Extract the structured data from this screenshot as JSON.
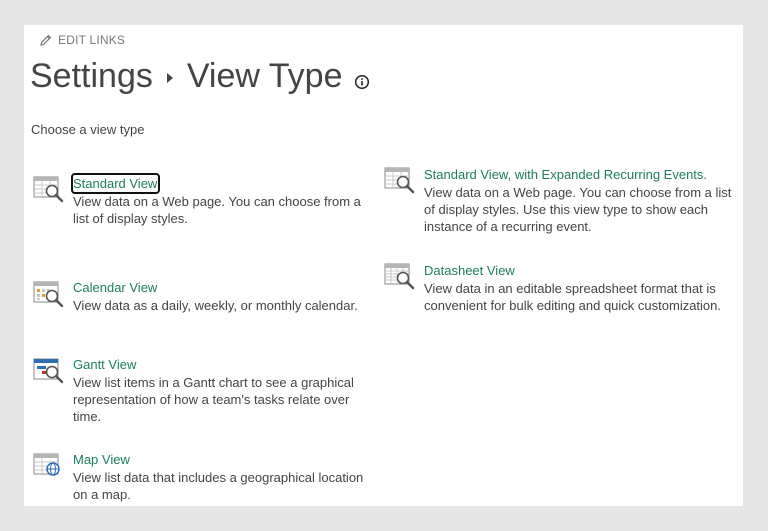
{
  "header": {
    "edit_links": "EDIT LINKS",
    "breadcrumb_root": "Settings",
    "breadcrumb_current": "View Type"
  },
  "subtitle": "Choose a view type",
  "view_types": {
    "standard": {
      "name": "Standard View",
      "description": "View data on a Web page. You can choose from a list of display styles."
    },
    "standard_recurring": {
      "name": "Standard View, with Expanded Recurring Events.",
      "description": "View data on a Web page. You can choose from a list of display styles. Use this view type to show each instance of a recurring event."
    },
    "calendar": {
      "name": "Calendar View",
      "description": "View data as a daily, weekly, or monthly calendar."
    },
    "datasheet": {
      "name": "Datasheet View",
      "description": "View data in an editable spreadsheet format that is convenient for bulk editing and quick customization."
    },
    "gantt": {
      "name": "Gantt View",
      "description": "View list items in a Gantt chart to see a graphical representation of how a team's tasks relate over time."
    },
    "map": {
      "name": "Map View",
      "description": "View list data that includes a geographical location on a map."
    }
  },
  "colors": {
    "link": "#1c7d5e",
    "text": "#444444",
    "background": "#e6e6e6",
    "panel": "#ffffff",
    "icon_accent": "#2f6db3"
  }
}
